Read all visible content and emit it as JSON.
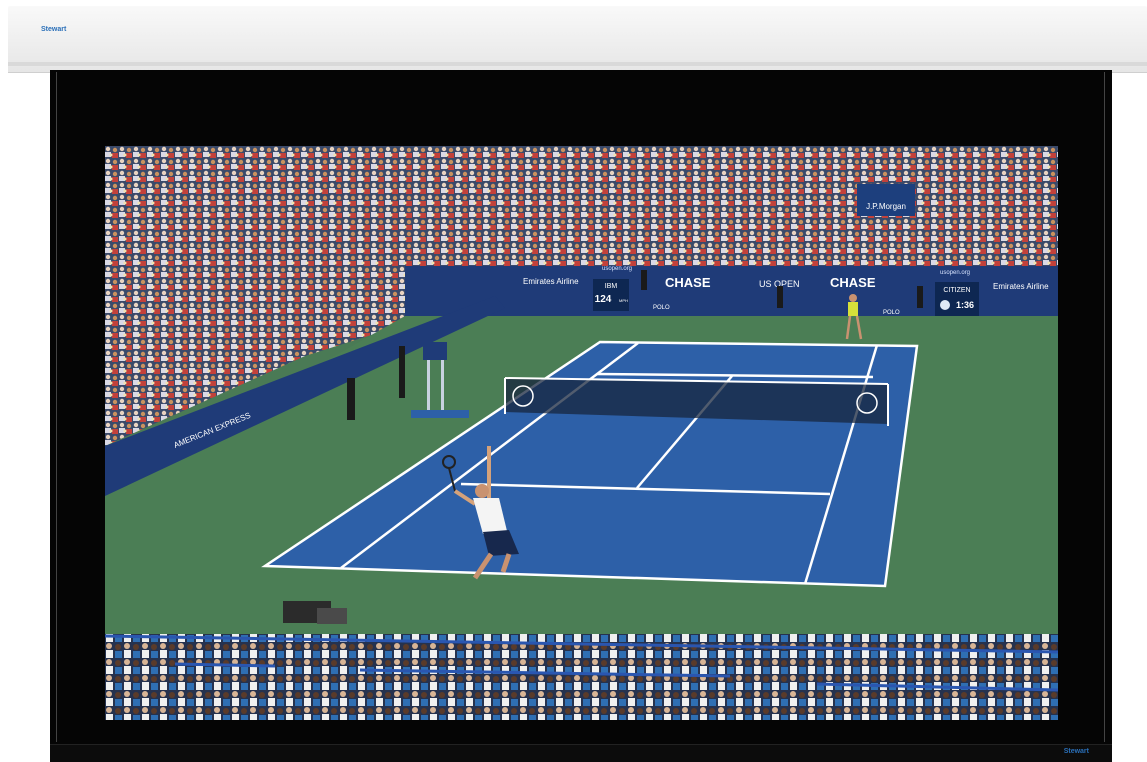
{
  "screen": {
    "brand_top": "Stewart",
    "brand_bottom": "Stewart"
  },
  "scene": {
    "signs": {
      "emirates_left": "Emirates Airline",
      "chase_1": "CHASE",
      "usopen": "US OPEN",
      "chase_2": "CHASE",
      "emirates_right": "Emirates Airline",
      "jpmorgan": "J.P.Morgan",
      "ibm": "IBM",
      "speed": "124",
      "speed_unit": "MPH",
      "citizen": "CITIZEN",
      "clock": "1:36",
      "american_express": "AMERICAN EXPRESS",
      "usopen_org": "usopen.org",
      "polo": "POLO"
    }
  }
}
